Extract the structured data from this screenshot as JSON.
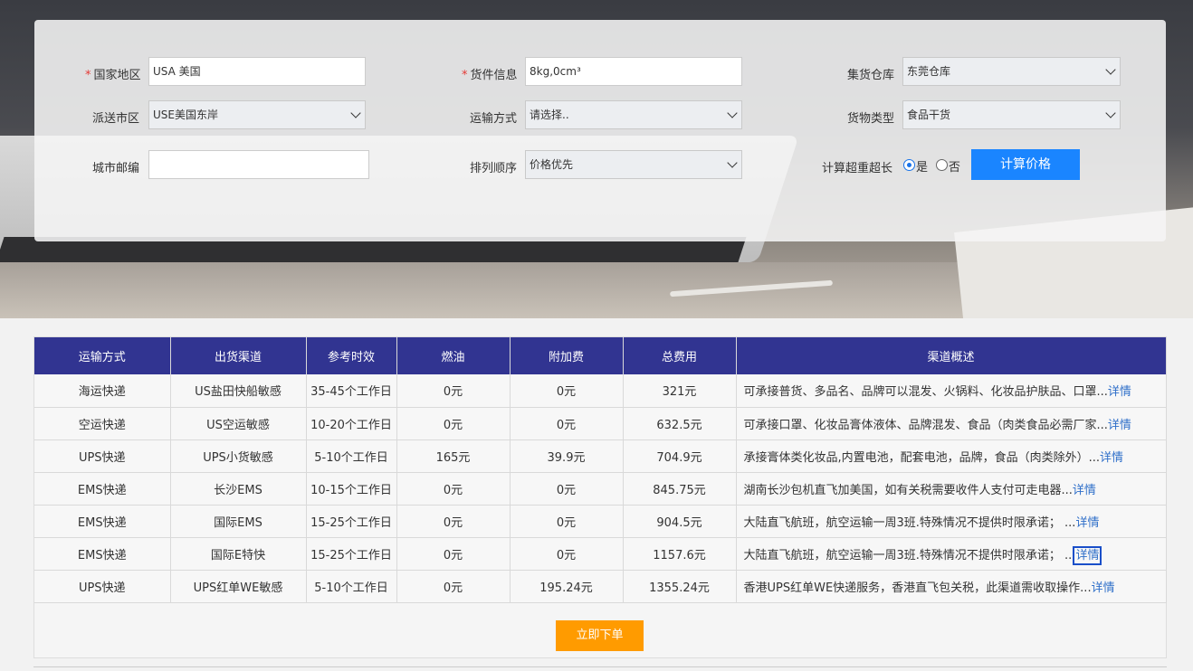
{
  "form": {
    "country": {
      "label": "国家地区",
      "value": "USA 美国"
    },
    "goods": {
      "label": "货件信息",
      "value": "8kg,0cm³"
    },
    "warehouse": {
      "label": "集货仓库",
      "value": "东莞仓库"
    },
    "delivery_area": {
      "label": "派送市区",
      "value": "USE美国东岸"
    },
    "transport": {
      "label": "运输方式",
      "value": "请选择.."
    },
    "cargo_type": {
      "label": "货物类型",
      "value": "食品干货"
    },
    "zipcode": {
      "label": "城市邮编",
      "value": ""
    },
    "sort": {
      "label": "排列顺序",
      "value": "价格优先"
    },
    "overweight": {
      "label": "计算超重超长",
      "yes": "是",
      "no": "否",
      "selected": "是"
    },
    "calc_button": "计算价格",
    "required_mark": "*"
  },
  "table": {
    "headers": [
      "运输方式",
      "出货渠道",
      "参考时效",
      "燃油",
      "附加费",
      "总费用",
      "渠道概述"
    ],
    "rows": [
      {
        "mode": "海运快递",
        "channel": "US盐田快船敏感",
        "time": "35-45个工作日",
        "fuel": "0元",
        "surcharge": "0元",
        "total": "321元",
        "desc": "可承接普货、多品名、品牌可以混发、火锅料、化妆品护肤品、口罩...",
        "detail": "详情"
      },
      {
        "mode": "空运快递",
        "channel": "US空运敏感",
        "time": "10-20个工作日",
        "fuel": "0元",
        "surcharge": "0元",
        "total": "632.5元",
        "desc": "可承接口罩、化妆品膏体液体、品牌混发、食品（肉类食品必需厂家...",
        "detail": "详情"
      },
      {
        "mode": "UPS快递",
        "channel": "UPS小货敏感",
        "time": "5-10个工作日",
        "fuel": "165元",
        "surcharge": "39.9元",
        "total": "704.9元",
        "desc": "承接膏体类化妆品,内置电池，配套电池，品牌，食品（肉类除外）...",
        "detail": "详情"
      },
      {
        "mode": "EMS快递",
        "channel": "长沙EMS",
        "time": "10-15个工作日",
        "fuel": "0元",
        "surcharge": "0元",
        "total": "845.75元",
        "desc": "湖南长沙包机直飞加美国，如有关税需要收件人支付可走电器...",
        "detail": "详情"
      },
      {
        "mode": "EMS快递",
        "channel": "国际EMS",
        "time": "15-25个工作日",
        "fuel": "0元",
        "surcharge": "0元",
        "total": "904.5元",
        "desc": "大陆直飞航班，航空运输一周3班.特殊情况不提供时限承诺； ...",
        "detail": "详情"
      },
      {
        "mode": "EMS快递",
        "channel": "国际E特快",
        "time": "15-25个工作日",
        "fuel": "0元",
        "surcharge": "0元",
        "total": "1157.6元",
        "desc": "大陆直飞航班，航空运输一周3班.特殊情况不提供时限承诺； ...",
        "detail": "详情"
      },
      {
        "mode": "UPS快递",
        "channel": "UPS红单WE敏感",
        "time": "5-10个工作日",
        "fuel": "0元",
        "surcharge": "195.24元",
        "total": "1355.24元",
        "desc": "香港UPS红单WE快递服务，香港直飞包关税，此渠道需收取操作...",
        "detail": "详情"
      }
    ]
  },
  "order_button": "立即下单",
  "colors": {
    "header_bg": "#313491",
    "calc_button": "#1a85ff",
    "order_button": "#ff9b00",
    "link": "#2f6fc9",
    "required": "#e53935"
  }
}
